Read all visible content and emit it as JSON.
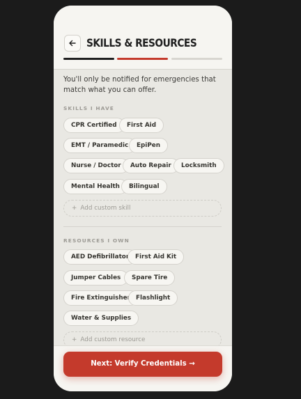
{
  "header": {
    "title": "SKILLS & RESOURCES",
    "back_icon": "arrow-left-icon"
  },
  "progress": {
    "steps": 3,
    "current_step": 2,
    "colors": [
      "#1f1f1f",
      "#c43a2c",
      "#d8d6d0"
    ]
  },
  "intro": "You'll only be notified for emergencies that match what you can offer.",
  "skills": {
    "label": "SKILLS I HAVE",
    "items": [
      "CPR Certified",
      "First Aid",
      "EMT / Paramedic",
      "EpiPen",
      "Nurse / Doctor",
      "Auto Repair",
      "Locksmith",
      "Mental Health",
      "Bilingual"
    ],
    "add_label": "Add custom skill"
  },
  "resources": {
    "label": "RESOURCES I OWN",
    "items": [
      "AED Defibrillator",
      "First Aid Kit",
      "Jumper Cables",
      "Spare Tire",
      "Fire Extinguisher",
      "Flashlight",
      "Water & Supplies"
    ],
    "add_label": "Add custom resource"
  },
  "footer": {
    "next_label": "Next: Verify Credentials →"
  },
  "colors": {
    "accent": "#c43a2c",
    "dark": "#1f1f1f",
    "background": "#1b1b1b"
  }
}
